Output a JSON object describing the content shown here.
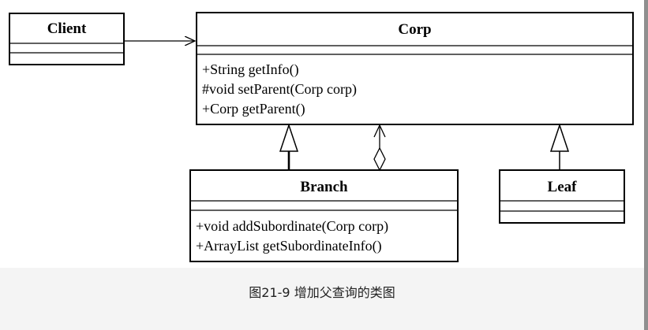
{
  "classes": {
    "client": {
      "name": "Client",
      "members": []
    },
    "corp": {
      "name": "Corp",
      "members": [
        "+String getInfo()",
        "#void setParent(Corp corp)",
        "+Corp getParent()"
      ]
    },
    "branch": {
      "name": "Branch",
      "members": [
        "+void addSubordinate(Corp corp)",
        "+ArrayList getSubordinateInfo()"
      ]
    },
    "leaf": {
      "name": "Leaf",
      "members": []
    }
  },
  "caption": "图21-9 增加父查询的类图"
}
